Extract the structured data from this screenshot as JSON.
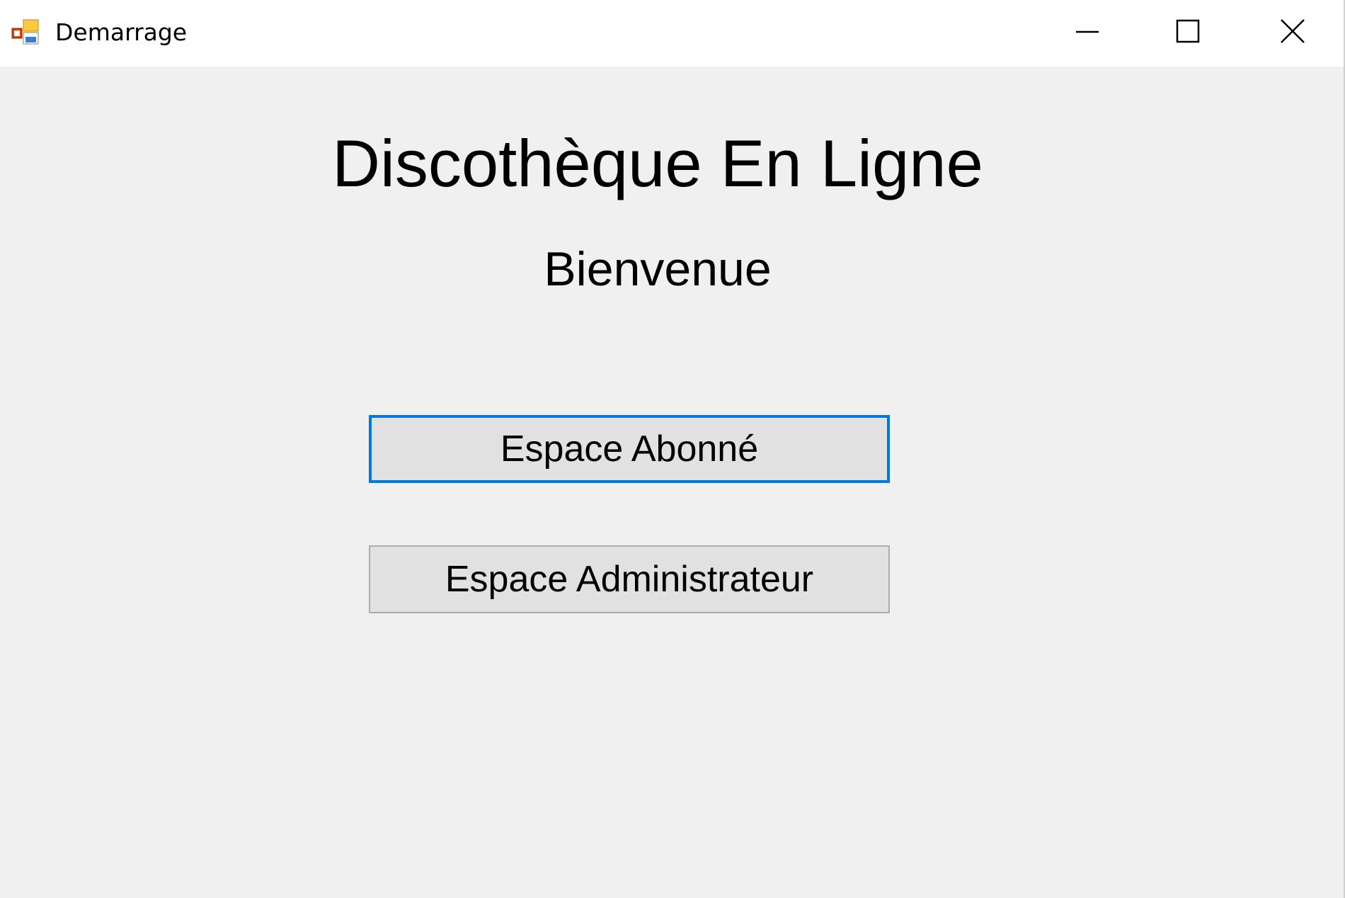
{
  "window": {
    "title": "Demarrage",
    "icon": "winforms-app-icon",
    "controls": {
      "minimize": "minimize-icon",
      "maximize": "maximize-icon",
      "close": "close-icon"
    }
  },
  "main": {
    "title": "Discothèque En Ligne",
    "subtitle": "Bienvenue",
    "buttons": [
      {
        "label": "Espace Abonné",
        "focused": true
      },
      {
        "label": "Espace Administrateur",
        "focused": false
      }
    ]
  },
  "colors": {
    "background": "#f0f0f0",
    "titlebar": "#ffffff",
    "button_face": "#e1e1e1",
    "focus_border": "#0078d7"
  }
}
